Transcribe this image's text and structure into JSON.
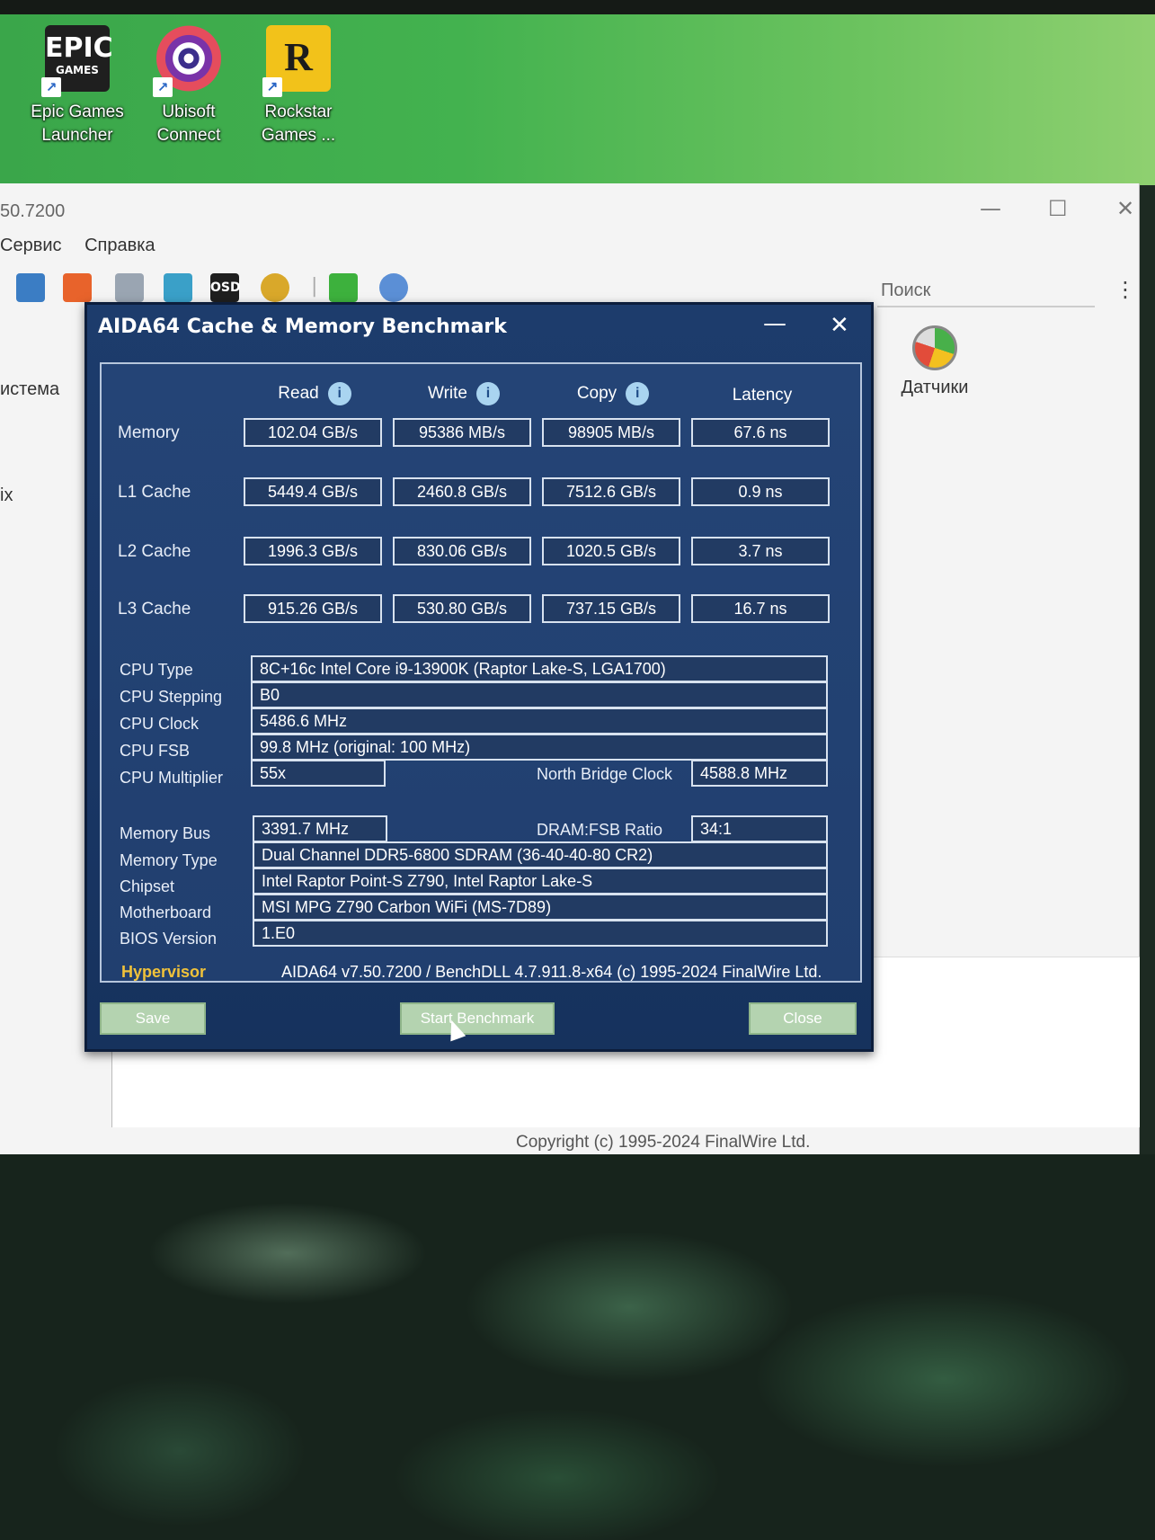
{
  "desktop": {
    "icons": [
      {
        "label_line1": "Epic Games",
        "label_line2": "Launcher",
        "glyph_text_1": "EPIC",
        "glyph_text_2": "GAMES"
      },
      {
        "label_line1": "Ubisoft",
        "label_line2": "Connect"
      },
      {
        "label_line1": "Rockstar",
        "label_line2": "Games ...",
        "glyph_text_1": "R"
      }
    ],
    "shortcut_arrow": "↗"
  },
  "main_window": {
    "title": "50.7200",
    "minimize": "—",
    "maximize": "☐",
    "close": "✕",
    "menu": [
      "Сервис",
      "Справка"
    ],
    "search_placeholder": "Поиск",
    "kebab": "⋮",
    "left_labels": [
      "истема",
      "ix"
    ],
    "sensor_label": "Датчики",
    "copyright": "Copyright (c) 1995-2024 FinalWire Ltd.",
    "toolbar_icons": [
      "computer-icon",
      "flame-icon",
      "report-icon",
      "users-icon",
      "osd-icon",
      "gauge-icon",
      "download-icon",
      "search-icon"
    ],
    "osd_text": "OSD",
    "divider": "|"
  },
  "bench": {
    "title": "AIDA64 Cache & Memory Benchmark",
    "minimize": "—",
    "close": "✕",
    "info_glyph": "i",
    "columns": [
      "Read",
      "Write",
      "Copy",
      "Latency"
    ],
    "rows": [
      {
        "label": "Memory",
        "values": [
          "102.04 GB/s",
          "95386 MB/s",
          "98905 MB/s",
          "67.6 ns"
        ]
      },
      {
        "label": "L1 Cache",
        "values": [
          "5449.4 GB/s",
          "2460.8 GB/s",
          "7512.6 GB/s",
          "0.9 ns"
        ]
      },
      {
        "label": "L2 Cache",
        "values": [
          "1996.3 GB/s",
          "830.06 GB/s",
          "1020.5 GB/s",
          "3.7 ns"
        ]
      },
      {
        "label": "L3 Cache",
        "values": [
          "915.26 GB/s",
          "530.80 GB/s",
          "737.15 GB/s",
          "16.7 ns"
        ]
      }
    ],
    "cpu": {
      "type_label": "CPU Type",
      "type_value": "8C+16c Intel Core i9-13900K  (Raptor Lake-S, LGA1700)",
      "stepping_label": "CPU Stepping",
      "stepping_value": "B0",
      "clock_label": "CPU Clock",
      "clock_value": "5486.6 MHz",
      "fsb_label": "CPU FSB",
      "fsb_value": "99.8 MHz  (original: 100 MHz)",
      "multiplier_label": "CPU Multiplier",
      "multiplier_value": "55x",
      "nb_clock_label": "North Bridge Clock",
      "nb_clock_value": "4588.8 MHz"
    },
    "memory": {
      "bus_label": "Memory Bus",
      "bus_value": "3391.7 MHz",
      "ratio_label": "DRAM:FSB Ratio",
      "ratio_value": "34:1",
      "type_label": "Memory Type",
      "type_value": "Dual Channel DDR5-6800 SDRAM  (36-40-40-80 CR2)",
      "chipset_label": "Chipset",
      "chipset_value": "Intel Raptor Point-S Z790, Intel Raptor Lake-S",
      "motherboard_label": "Motherboard",
      "motherboard_value": "MSI MPG Z790 Carbon WiFi (MS-7D89)",
      "bios_label": "BIOS Version",
      "bios_value": "1.E0"
    },
    "hypervisor": "Hypervisor",
    "version": "AIDA64 v7.50.7200 / BenchDLL 4.7.911.8-x64  (c) 1995-2024 FinalWire Ltd.",
    "buttons": {
      "save": "Save",
      "start": "Start Benchmark",
      "close": "Close"
    }
  }
}
